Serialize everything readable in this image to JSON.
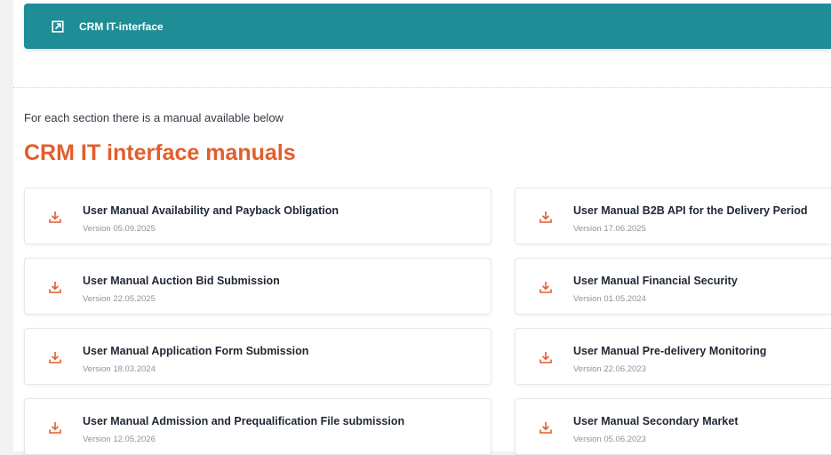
{
  "banner": {
    "icon": "external-link-icon",
    "title": "CRM IT-interface"
  },
  "intro_text": "For each section there is a manual available below",
  "heading": "CRM IT interface manuals",
  "colors": {
    "banner_bg": "#1e8d96",
    "accent": "#e35d2c"
  },
  "manuals_left": [
    {
      "title": "User Manual Availability and Payback Obligation",
      "version": "Version 05.09.2025",
      "icon": "download-icon"
    },
    {
      "title": "User Manual Auction Bid Submission",
      "version": "Version 22.05.2025",
      "icon": "download-icon"
    },
    {
      "title": "User Manual Application Form Submission",
      "version": "Version 18.03.2024",
      "icon": "download-icon"
    },
    {
      "title": "User Manual Admission and Prequalification File submission",
      "version": "Version 12.05.2026",
      "icon": "download-icon"
    }
  ],
  "manuals_right": [
    {
      "title": "User Manual B2B API for the Delivery Period",
      "version": "Version 17.06.2025",
      "icon": "download-icon"
    },
    {
      "title": "User Manual Financial Security",
      "version": "Version 01.05.2024",
      "icon": "download-icon"
    },
    {
      "title": "User Manual Pre-delivery Monitoring",
      "version": "Version 22.06.2023",
      "icon": "download-icon"
    },
    {
      "title": "User Manual Secondary Market",
      "version": "Version 05.06.2023",
      "icon": "download-icon"
    }
  ]
}
